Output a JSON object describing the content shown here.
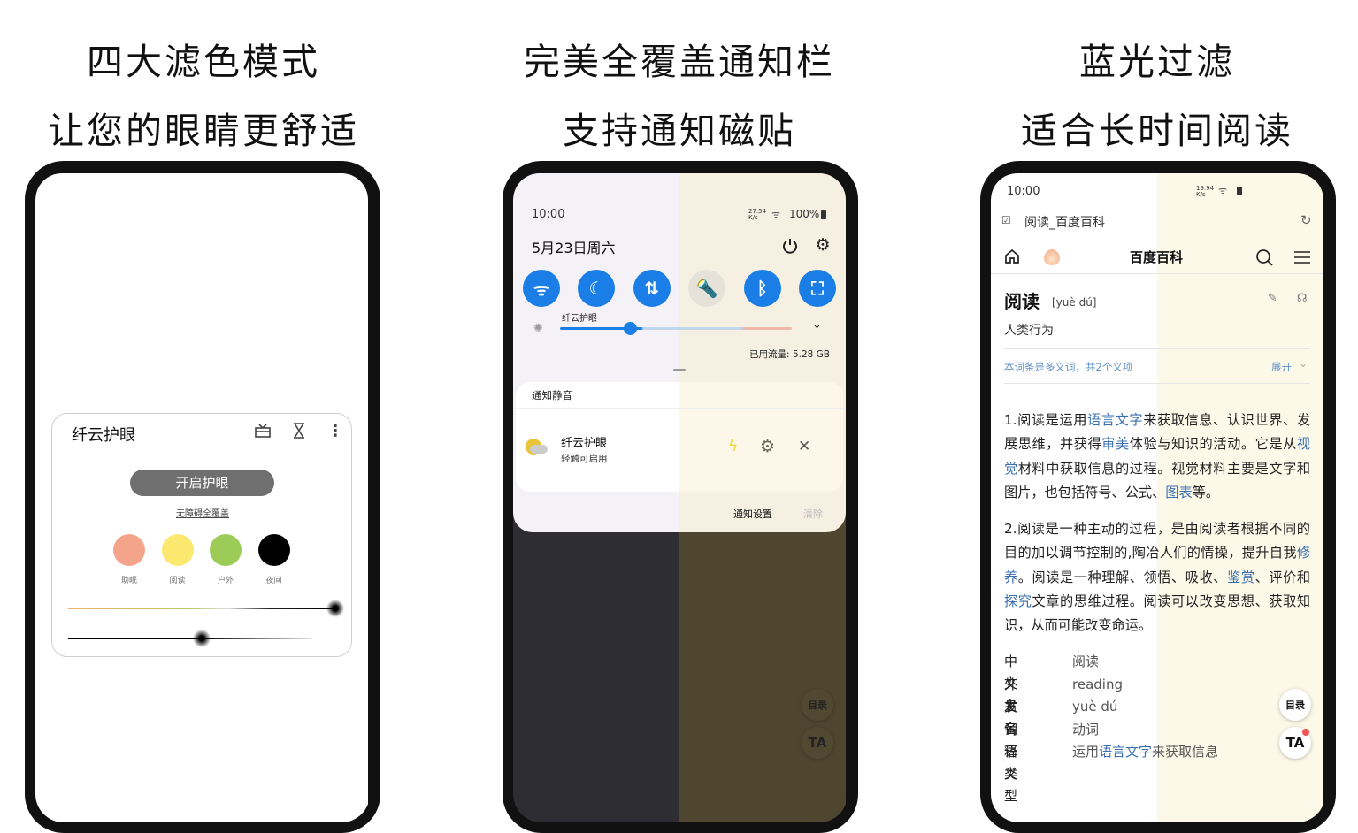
{
  "headings": [
    {
      "line1": "四大滤色模式",
      "line2": "让您的眼睛更舒适"
    },
    {
      "line1": "完美全覆盖通知栏",
      "line2": "支持通知磁贴"
    },
    {
      "line1": "蓝光过滤",
      "line2": "适合长时间阅读"
    }
  ],
  "widget": {
    "title": "纤云护眼",
    "icons": [
      "gift-icon",
      "hourglass-icon",
      "more-vert-icon"
    ],
    "enable_button": "开启护眼",
    "accessibility_link": "无障碍全覆盖",
    "modes": [
      {
        "label": "助眠",
        "color": "#f4a48a"
      },
      {
        "label": "阅读",
        "color": "#fbe86e"
      },
      {
        "label": "户外",
        "color": "#9ccc57"
      },
      {
        "label": "夜间",
        "color": "#000000"
      }
    ],
    "filter_slider_value": 1.0,
    "dim_slider_value": 0.55
  },
  "notification_shade": {
    "time": "10:00",
    "net_speed": "27.54 K/s",
    "battery": "100%",
    "date": "5月23日周六",
    "tiles": [
      {
        "icon": "wifi-icon",
        "active": true
      },
      {
        "icon": "eye-care-icon",
        "active": true,
        "label": "纤云护眼"
      },
      {
        "icon": "data-transfer-icon",
        "active": true
      },
      {
        "icon": "flashlight-icon",
        "active": false
      },
      {
        "icon": "bluetooth-icon",
        "active": true
      },
      {
        "icon": "screenshot-icon",
        "active": true
      }
    ],
    "brightness": 0.3,
    "data_usage": "已用流量: 5.28 GB",
    "silent_header": "通知静音",
    "notification": {
      "title": "纤云护眼",
      "subtitle": "轻触可启用"
    },
    "notif_settings": "通知设置",
    "clear": "清除",
    "accent": "#1a7ee6"
  },
  "browser": {
    "time": "10:00",
    "net_speed": "19.94 K/s",
    "page_title": "阅读_百度百科",
    "site_title": "百度百科",
    "entry_title": "阅读",
    "pinyin": "[yuè dú]",
    "summary": "人类行为",
    "polysemy_note": "本词条是多义词，共2个义项",
    "expand": "展开",
    "paragraphs": [
      [
        {
          "t": "1.阅读是运用"
        },
        {
          "t": "语言文字",
          "link": true
        },
        {
          "t": "来获取信息、认识世界、发展思维，并获得"
        },
        {
          "t": "审美",
          "link": true
        },
        {
          "t": "体验与知识的活动。它是从"
        },
        {
          "t": "视觉",
          "link": true
        },
        {
          "t": "材料中获取信息的过程。视觉材料主要是文字和图片，也包括符号、公式、"
        },
        {
          "t": "图表",
          "link": true
        },
        {
          "t": "等。"
        }
      ],
      [
        {
          "t": "2.阅读是一种主动的过程，是由阅读者根据不同的目的加以调节控制的,陶冶人们的情操，提升自我"
        },
        {
          "t": "修养",
          "link": true
        },
        {
          "t": "。阅读是一种理解、领悟、吸收、"
        },
        {
          "t": "鉴赏",
          "link": true
        },
        {
          "t": "、评价和"
        },
        {
          "t": "探究",
          "link": true
        },
        {
          "t": "文章的思维过程。阅读可以改变思想、获取知识，从而可能改变命运。"
        }
      ]
    ],
    "infobox": [
      {
        "label": "中文名",
        "value": [
          {
            "t": "阅读"
          }
        ]
      },
      {
        "label": "外文名",
        "value": [
          {
            "t": "reading"
          }
        ]
      },
      {
        "label": "发音",
        "value": [
          {
            "t": "yuè dú"
          }
        ]
      },
      {
        "label": "词语类型",
        "value": [
          {
            "t": "动词"
          }
        ]
      },
      {
        "label": "释义",
        "value": [
          {
            "t": "运用"
          },
          {
            "t": "语言文字",
            "link": true
          },
          {
            "t": "来获取信息"
          }
        ]
      }
    ],
    "toc_button": "目录",
    "font_button": "TA"
  }
}
